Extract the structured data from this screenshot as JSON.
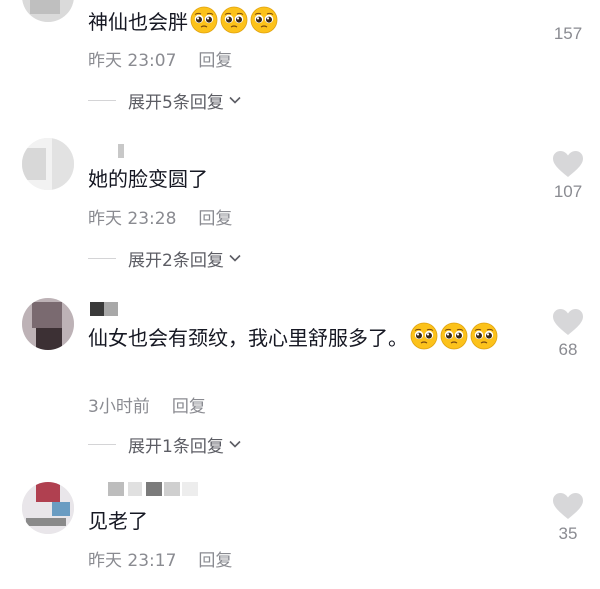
{
  "comments": [
    {
      "text": "神仙也会胖",
      "emoji_count": 3,
      "time": "昨天 23:07",
      "reply_label": "回复",
      "expand_label": "展开5条回复",
      "likes": "157"
    },
    {
      "text": "她的脸变圆了",
      "emoji_count": 0,
      "time": "昨天 23:28",
      "reply_label": "回复",
      "expand_label": "展开2条回复",
      "likes": "107"
    },
    {
      "text": "仙女也会有颈纹，我心里舒服多了。",
      "emoji_count": 3,
      "time": "3小时前",
      "reply_label": "回复",
      "expand_label": "展开1条回复",
      "likes": "68"
    },
    {
      "text": "见老了",
      "emoji_count": 0,
      "time": "昨天 23:17",
      "reply_label": "回复",
      "likes": "35"
    }
  ],
  "icons": {
    "like": "heart-icon",
    "expand": "chevron-down-icon",
    "emoji": "pleading-face-emoji"
  },
  "colors": {
    "text": "#161823",
    "meta": "#8a8b91",
    "heart": "#d7d7d9",
    "emoji": "#fcc21b"
  }
}
